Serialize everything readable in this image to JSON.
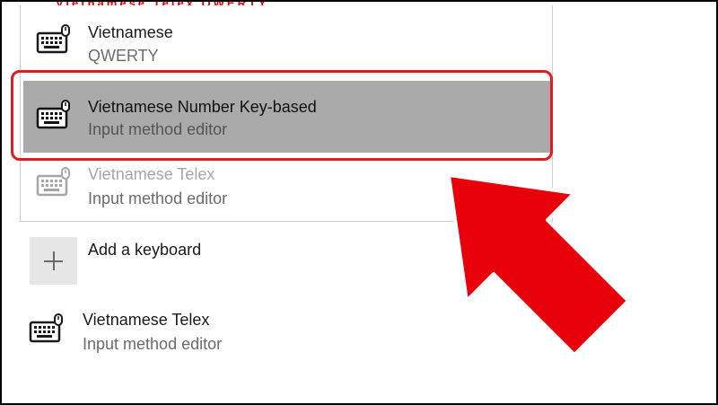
{
  "header_cutoff": "Vietnamese Telex  QWERTY",
  "layouts": [
    {
      "name": "Vietnamese",
      "type": "QWERTY",
      "icon": "keyboard-icon"
    },
    {
      "name": "Vietnamese Number Key-based",
      "type": "Input method editor",
      "icon": "keyboard-icon",
      "selected": true
    },
    {
      "name": "Vietnamese Telex",
      "type": "Input method editor",
      "icon": "keyboard-icon",
      "disabled": true
    }
  ],
  "add_keyboard": {
    "label": "Add a keyboard",
    "icon": "plus-icon"
  },
  "installed_keyboard": {
    "name": "Vietnamese Telex",
    "type": "Input method editor",
    "icon": "keyboard-icon"
  },
  "colors": {
    "highlight": "#e11b22",
    "selection": "#aaaaaa",
    "arrow": "#e8000b"
  }
}
